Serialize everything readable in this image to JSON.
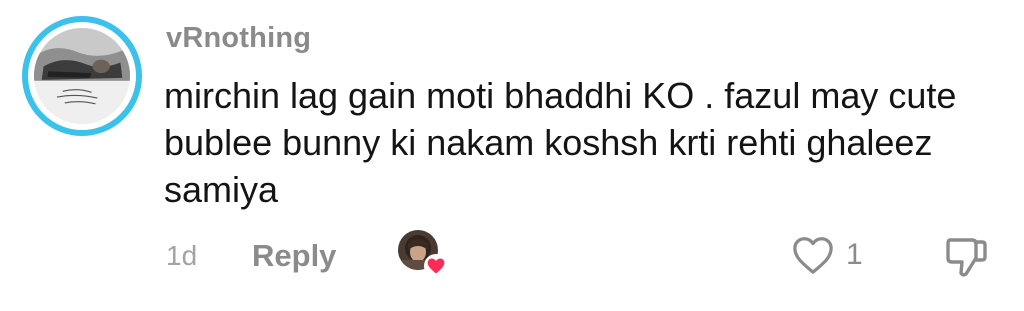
{
  "comment": {
    "username": "vRnothing",
    "text": "mirchin lag gain moti bhaddhi KO . fazul may cute bublee bunny ki nakam koshsh krti rehti ghaleez samiya",
    "time": "1d",
    "reply_label": "Reply",
    "like_count": "1",
    "liked_by_creator": true
  },
  "icons": {
    "avatar": "profile-avatar",
    "creator_liked": "creator-avatar-with-heart",
    "like": "heart-outline-icon",
    "dislike": "thumbs-down-icon"
  },
  "colors": {
    "avatar_ring": "#3bc1ea",
    "username": "#8a8a8a",
    "text": "#141414",
    "meta": "#8b8b8b",
    "heart_badge": "#fe2c55"
  }
}
